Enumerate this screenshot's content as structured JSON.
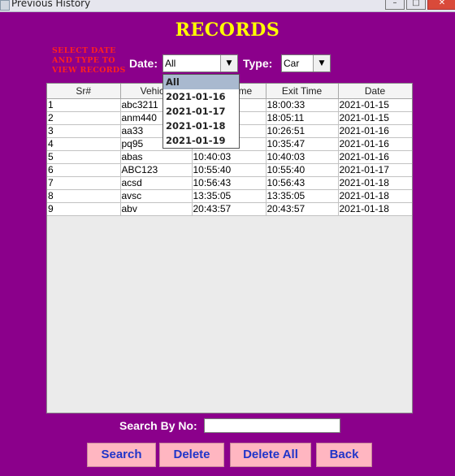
{
  "window": {
    "title": "Previous History"
  },
  "title": "RECORDS",
  "hint": "SELECT DATE AND TYPE TO VIEW RECORDS",
  "filters": {
    "date_label": "Date:",
    "date_value": "All",
    "date_options": [
      "All",
      "2021-01-16",
      "2021-01-17",
      "2021-01-18",
      "2021-01-19"
    ],
    "type_label": "Type:",
    "type_value": "Car"
  },
  "table": {
    "columns": [
      "Sr#",
      "Vehicle",
      "Entry Time",
      "Exit Time",
      "Date"
    ],
    "rows": [
      [
        "1",
        "abc3211",
        "",
        "18:00:33",
        "2021-01-15"
      ],
      [
        "2",
        "anm440",
        "",
        "18:05:11",
        "2021-01-15"
      ],
      [
        "3",
        "aa33",
        "",
        "10:26:51",
        "2021-01-16"
      ],
      [
        "4",
        "pq95",
        "",
        "10:35:47",
        "2021-01-16"
      ],
      [
        "5",
        "abas",
        "10:40:03",
        "10:40:03",
        "2021-01-16"
      ],
      [
        "6",
        "ABC123",
        "10:55:40",
        "10:55:40",
        "2021-01-17"
      ],
      [
        "7",
        "acsd",
        "10:56:43",
        "10:56:43",
        "2021-01-18"
      ],
      [
        "8",
        "avsc",
        "13:35:05",
        "13:35:05",
        "2021-01-18"
      ],
      [
        "9",
        "abv",
        "20:43:57",
        "20:43:57",
        "2021-01-18"
      ]
    ]
  },
  "search": {
    "label": "Search By No:",
    "value": ""
  },
  "buttons": {
    "search": "Search",
    "delete": "Delete",
    "delete_all": "Delete All",
    "back": "Back"
  },
  "colors": {
    "background": "#8b008b",
    "title": "#ffff00",
    "hint": "#ff2020",
    "button_bg": "#ffb6c1",
    "button_text": "#1f35c9"
  }
}
